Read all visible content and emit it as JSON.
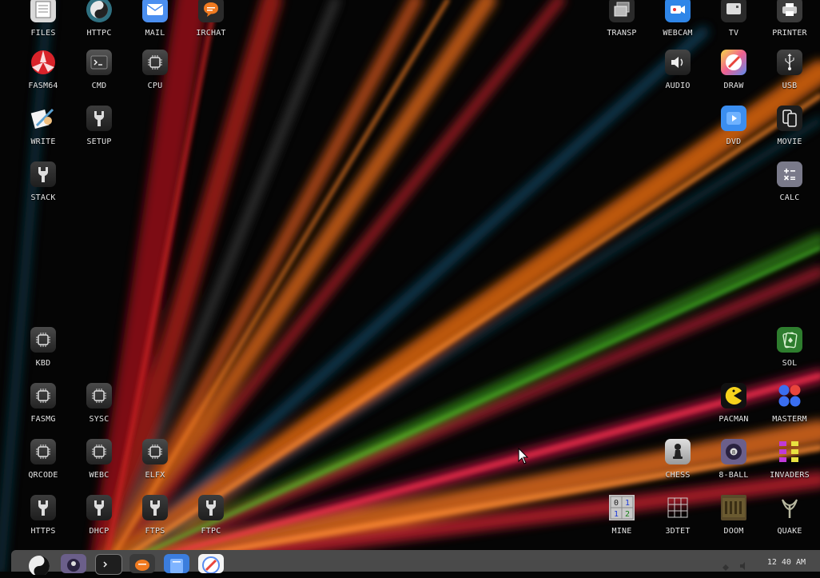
{
  "desktop": {
    "left_icons": [
      {
        "label": "FILES",
        "icon": "files-icon"
      },
      {
        "label": "HTTPC",
        "icon": "yin-yang-icon"
      },
      {
        "label": "MAIL",
        "icon": "mail-icon"
      },
      {
        "label": "IRCHAT",
        "icon": "chat-icon"
      },
      {
        "label": "FASM64",
        "icon": "fasm-icon"
      },
      {
        "label": "CMD",
        "icon": "terminal-icon"
      },
      {
        "label": "CPU",
        "icon": "chip-icon"
      },
      {
        "label": "WRITE",
        "icon": "pen-icon"
      },
      {
        "label": "SETUP",
        "icon": "wrench-icon"
      },
      {
        "label": "STACK",
        "icon": "wrench-icon"
      },
      {
        "label": "KBD",
        "icon": "chip-icon"
      },
      {
        "label": "FASMG",
        "icon": "chip-icon"
      },
      {
        "label": "SYSC",
        "icon": "chip-icon"
      },
      {
        "label": "QRCODE",
        "icon": "chip-icon"
      },
      {
        "label": "WEBC",
        "icon": "chip-icon"
      },
      {
        "label": "ELFX",
        "icon": "chip-icon"
      },
      {
        "label": "HTTPS",
        "icon": "wrench-icon"
      },
      {
        "label": "DHCP",
        "icon": "wrench-icon"
      },
      {
        "label": "FTPS",
        "icon": "wrench-icon"
      },
      {
        "label": "FTPC",
        "icon": "wrench-icon"
      }
    ],
    "right_icons": [
      {
        "label": "TRANSP",
        "icon": "transp-icon"
      },
      {
        "label": "WEBCAM",
        "icon": "webcam-icon"
      },
      {
        "label": "TV",
        "icon": "tv-icon"
      },
      {
        "label": "PRINTER",
        "icon": "printer-icon"
      },
      {
        "label": "AUDIO",
        "icon": "speaker-icon"
      },
      {
        "label": "DRAW",
        "icon": "draw-icon"
      },
      {
        "label": "USB",
        "icon": "usb-icon"
      },
      {
        "label": "DVD",
        "icon": "dvd-icon"
      },
      {
        "label": "MOVIE",
        "icon": "movie-icon"
      },
      {
        "label": "CALC",
        "icon": "calculator-icon"
      },
      {
        "label": "SOL",
        "icon": "cards-icon"
      },
      {
        "label": "PACMAN",
        "icon": "pacman-icon"
      },
      {
        "label": "MASTERM",
        "icon": "mastermind-icon"
      },
      {
        "label": "CHESS",
        "icon": "chess-pawn-icon"
      },
      {
        "label": "8-BALL",
        "icon": "eight-ball-icon"
      },
      {
        "label": "INVADERS",
        "icon": "invaders-icon"
      },
      {
        "label": "MINE",
        "icon": "minesweeper-icon"
      },
      {
        "label": "3DTET",
        "icon": "grid-icon"
      },
      {
        "label": "DOOM",
        "icon": "doom-icon"
      },
      {
        "label": "QUAKE",
        "icon": "quake-icon"
      }
    ]
  },
  "taskbar": {
    "apps": [
      {
        "icon": "yin-yang-icon",
        "color": "#1a1a1a"
      },
      {
        "icon": "eight-ball-icon",
        "color": "#6b5f8a"
      },
      {
        "icon": "terminal-icon",
        "color": "#1e1e1e"
      },
      {
        "icon": "chat-icon",
        "color": "#3a3a3a"
      },
      {
        "icon": "files-icon",
        "color": "#3b7ddd"
      },
      {
        "icon": "draw-icon",
        "color": "#f4f4f4"
      }
    ],
    "clock": "12 40 AM"
  }
}
